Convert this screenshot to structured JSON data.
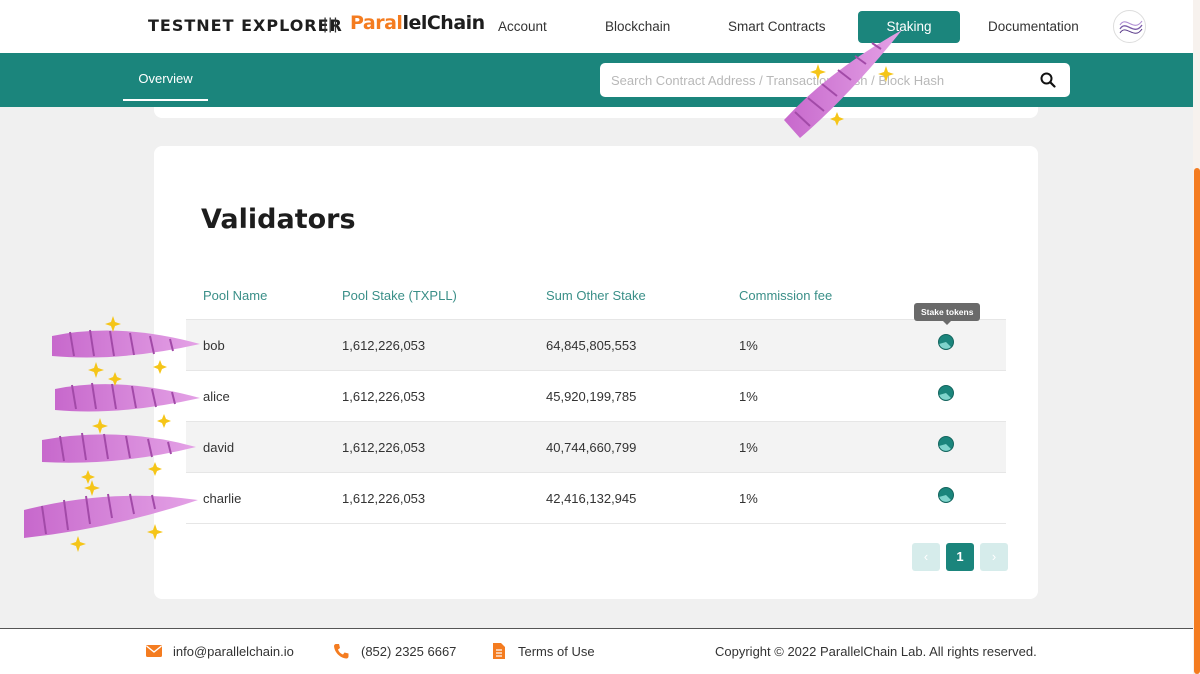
{
  "header": {
    "brand": "TESTNET EXPLORER",
    "separator": "|||",
    "logo_part1": "Paral",
    "logo_part2": "lelChain",
    "nav": [
      {
        "label": "Account"
      },
      {
        "label": "Blockchain"
      },
      {
        "label": "Smart Contracts"
      },
      {
        "label": "Staking",
        "active": true
      },
      {
        "label": "Documentation"
      }
    ]
  },
  "subnav": {
    "tab": "Overview",
    "search_placeholder": "Search Contract Address / Transaction Hash / Block Hash"
  },
  "validators": {
    "title": "Validators",
    "columns": [
      "Pool Name",
      "Pool Stake (TXPLL)",
      "Sum Other Stake",
      "Commission fee"
    ],
    "rows": [
      {
        "name": "bob",
        "pool_stake": "1,612,226,053",
        "other_stake": "64,845,805,553",
        "commission": "1%"
      },
      {
        "name": "alice",
        "pool_stake": "1,612,226,053",
        "other_stake": "45,920,199,785",
        "commission": "1%"
      },
      {
        "name": "david",
        "pool_stake": "1,612,226,053",
        "other_stake": "40,744,660,799",
        "commission": "1%"
      },
      {
        "name": "charlie",
        "pool_stake": "1,612,226,053",
        "other_stake": "42,416,132,945",
        "commission": "1%"
      }
    ],
    "tooltip": "Stake tokens",
    "pagination": {
      "prev": "‹",
      "current": "1",
      "next": "›"
    }
  },
  "footer": {
    "email": "info@parallelchain.io",
    "phone": "(852) 2325 6667",
    "terms": "Terms of Use",
    "copyright": "Copyright © 2022 ParallelChain Lab. All rights reserved."
  },
  "colors": {
    "primary": "#1b857c",
    "accent": "#f47c20",
    "sticker": "#d27ed6"
  },
  "icons": {
    "search": "search-icon",
    "stake": "stake-token-icon",
    "email": "mail-icon",
    "phone": "phone-icon",
    "terms": "document-icon"
  }
}
